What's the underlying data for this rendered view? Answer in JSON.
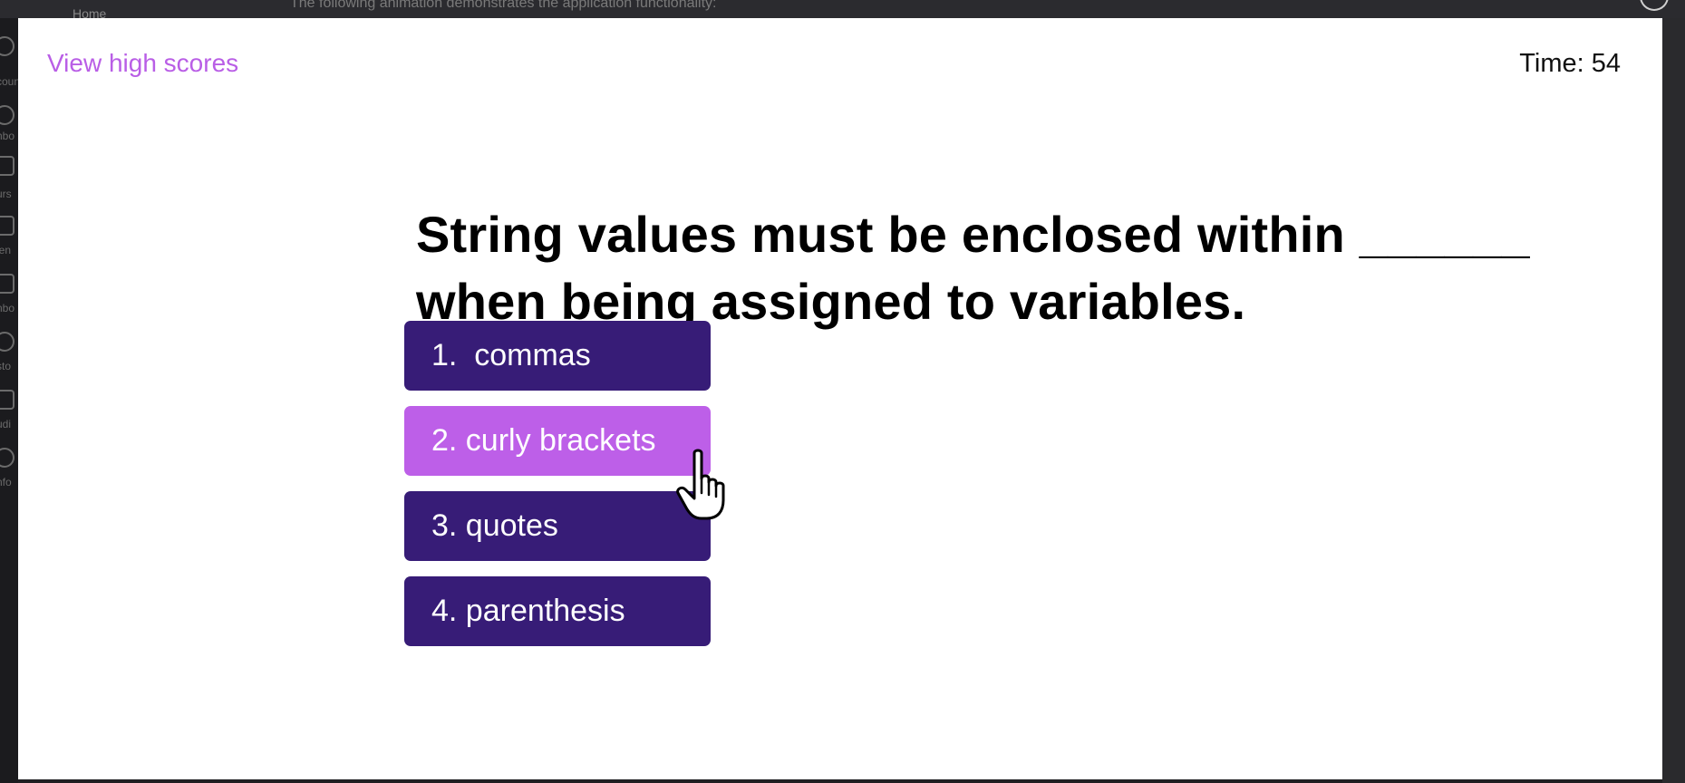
{
  "background": {
    "breadcrumb": "Home",
    "caption": "The following animation demonstrates the application functionality:",
    "sidebar_items": [
      "count",
      "hbo",
      "urs",
      "len",
      "nbo",
      "sto",
      "udi",
      "nfo"
    ]
  },
  "header": {
    "high_scores_label": "View high scores",
    "timer_label": "Time: 54"
  },
  "question": {
    "text": "String values must be enclosed within ______ when being assigned to variables."
  },
  "answers": [
    {
      "label": "1.  commas",
      "state": "default"
    },
    {
      "label": "2. curly brackets",
      "state": "hover"
    },
    {
      "label": "3. quotes",
      "state": "default"
    },
    {
      "label": "4. parenthesis",
      "state": "default"
    }
  ],
  "colors": {
    "accent": "#b95ee6",
    "button": "#371c77",
    "button_hover": "#bd5fe8"
  },
  "icons": {
    "cursor": "pointer-hand-cursor-icon",
    "close": "close-icon"
  }
}
